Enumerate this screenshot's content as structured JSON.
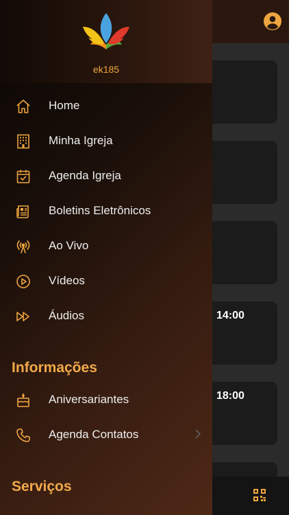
{
  "colors": {
    "accent": "#f0a640",
    "drawer_start": "#0a0604",
    "drawer_end": "#4e2817",
    "card": "#1b1b1b"
  },
  "app": {
    "profile_icon": "account-circle-icon",
    "qr_icon": "qr-code-icon",
    "cards": [
      {
        "time": ""
      },
      {
        "time": ""
      },
      {
        "time": ""
      },
      {
        "time": "14:00"
      },
      {
        "time": "18:00"
      }
    ]
  },
  "drawer": {
    "username": "ek185",
    "menu": [
      {
        "label": "Home",
        "icon": "home-icon"
      },
      {
        "label": "Minha Igreja",
        "icon": "building-icon"
      },
      {
        "label": "Agenda Igreja",
        "icon": "calendar-check-icon"
      },
      {
        "label": "Boletins Eletrônicos",
        "icon": "newspaper-icon"
      },
      {
        "label": "Ao Vivo",
        "icon": "broadcast-icon"
      },
      {
        "label": "Vídeos",
        "icon": "play-circle-icon"
      },
      {
        "label": "Áudios",
        "icon": "fast-forward-icon"
      }
    ],
    "info_section": {
      "title": "Informações",
      "items": [
        {
          "label": "Aniversariantes",
          "icon": "cake-icon"
        },
        {
          "label": "Agenda Contatos",
          "icon": "phone-icon"
        }
      ]
    },
    "services_section": {
      "title": "Serviços"
    }
  }
}
